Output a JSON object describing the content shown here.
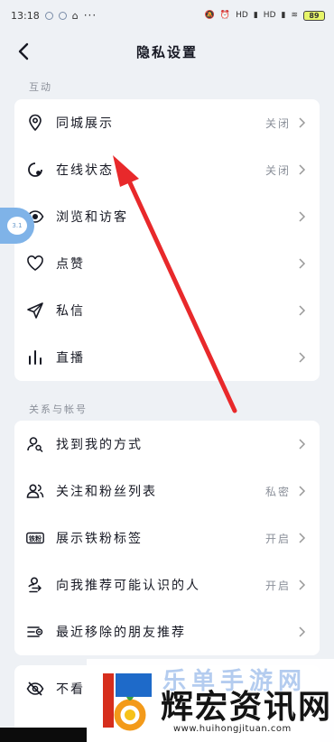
{
  "status_bar": {
    "time": "13:18",
    "dots": "···",
    "network_hd_1": "HD",
    "network_hd_2": "HD",
    "battery": "89"
  },
  "header": {
    "title": "隐私设置"
  },
  "sections": [
    {
      "label": "互动",
      "items": [
        {
          "name": "city-display",
          "label": "同城展示",
          "value": "关闭",
          "icon": "location-pin-icon"
        },
        {
          "name": "online-status",
          "label": "在线状态",
          "value": "关闭",
          "icon": "online-status-icon"
        },
        {
          "name": "browse-visitors",
          "label": "浏览和访客",
          "value": "",
          "icon": "eye-icon"
        },
        {
          "name": "likes",
          "label": "点赞",
          "value": "",
          "icon": "heart-icon"
        },
        {
          "name": "messages",
          "label": "私信",
          "value": "",
          "icon": "send-icon"
        },
        {
          "name": "live",
          "label": "直播",
          "value": "",
          "icon": "bar-chart-icon"
        }
      ]
    },
    {
      "label": "关系与帐号",
      "items": [
        {
          "name": "find-me",
          "label": "找到我的方式",
          "value": "",
          "icon": "person-search-icon"
        },
        {
          "name": "follow-fans-list",
          "label": "关注和粉丝列表",
          "value": "私密",
          "icon": "people-icon"
        },
        {
          "name": "iron-fan-tag",
          "label": "展示铁粉标签",
          "value": "开启",
          "icon": "iron-fan-badge-icon",
          "badge": "铁粉"
        },
        {
          "name": "recommend-known",
          "label": "向我推荐可能认识的人",
          "value": "开启",
          "icon": "recommend-person-icon"
        },
        {
          "name": "removed-friends",
          "label": "最近移除的朋友推荐",
          "value": "",
          "icon": "list-remove-icon"
        }
      ]
    },
    {
      "label": "",
      "items": [
        {
          "name": "hidden",
          "label": "不看",
          "value": "",
          "icon": "eye-off-icon"
        }
      ]
    }
  ],
  "float_bubble": {
    "text": "3.1"
  },
  "watermark": {
    "faint": "乐单手游网",
    "main": "辉宏资讯网",
    "url": "www.huihongjituan.com"
  }
}
